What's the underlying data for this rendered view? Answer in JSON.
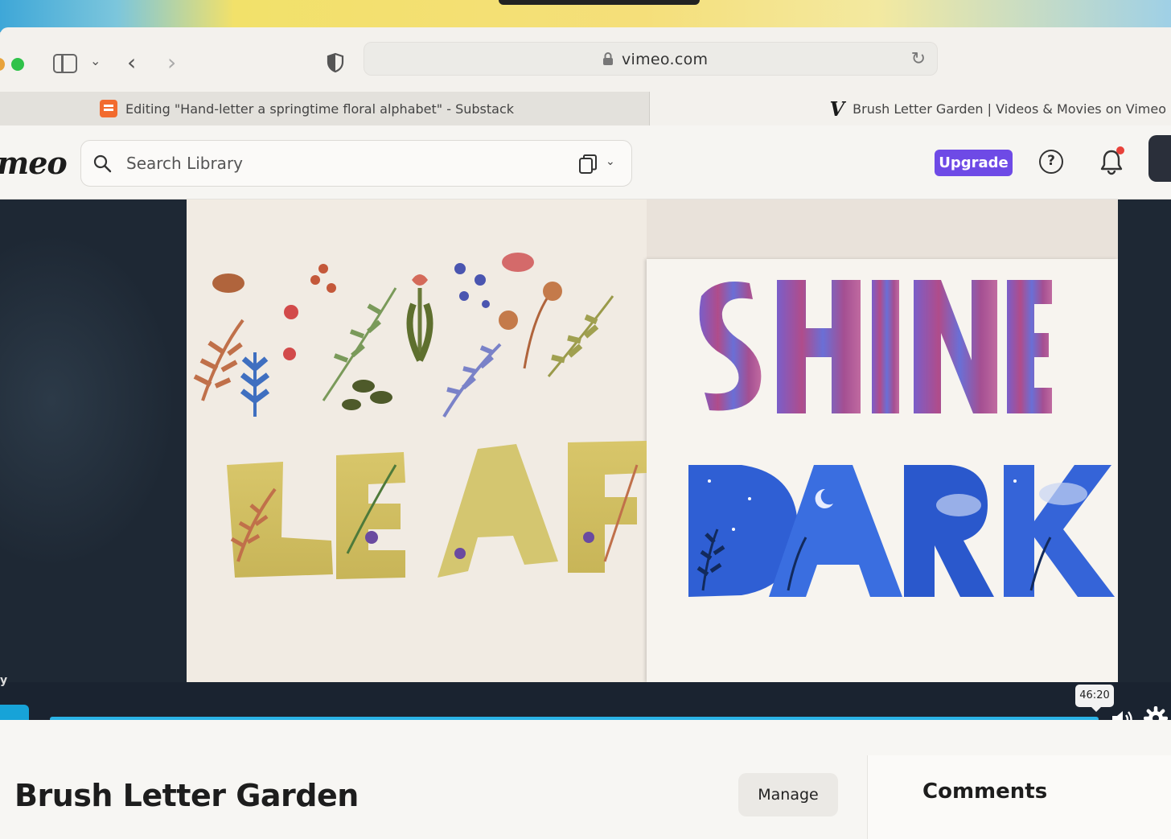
{
  "browser": {
    "address_url": "vimeo.com",
    "tabs": [
      {
        "label": "Editing \"Hand-letter a springtime floral alphabet\" - Substack",
        "icon": "substack-icon"
      },
      {
        "label": "Brush Letter Garden | Videos & Movies on Vimeo",
        "icon": "vimeo-icon"
      }
    ]
  },
  "app": {
    "logo_text": "meo",
    "search_placeholder": "Search Library",
    "upgrade_label": "Upgrade",
    "help_label": "?",
    "accent_color": "#6e4ae6",
    "progress_color": "#2bb3e6"
  },
  "player": {
    "side_label": "y",
    "time_tooltip": "46:20",
    "artwork_words": [
      "LEAF",
      "SHINE",
      "DARK"
    ]
  },
  "video": {
    "title": "Brush Letter Garden",
    "manage_label": "Manage",
    "comments_label": "Comments"
  }
}
